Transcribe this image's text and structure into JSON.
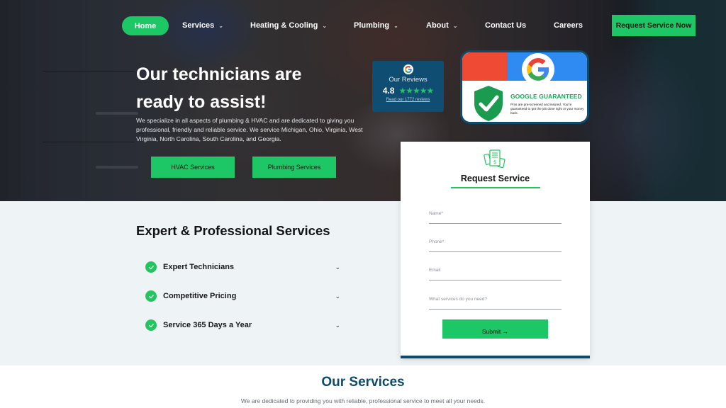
{
  "nav": {
    "items": [
      {
        "label": "Home",
        "dropdown": false,
        "active": true
      },
      {
        "label": "Services",
        "dropdown": true
      },
      {
        "label": "Heating & Cooling",
        "dropdown": true
      },
      {
        "label": "Plumbing",
        "dropdown": true
      },
      {
        "label": "About",
        "dropdown": true
      },
      {
        "label": "Contact Us",
        "dropdown": false
      },
      {
        "label": "Careers",
        "dropdown": false
      }
    ],
    "chevron": "⌄",
    "cta_label": "Request Service Now"
  },
  "hero": {
    "title_line1": "Our technicians are",
    "title_line2": "ready to assist!",
    "description": "We specialize in all aspects of plumbing & HVAC and are dedicated to giving you professional, friendly and reliable service.  We service Michigan, Ohio, Virginia, West Virginia, North Carolina, South Carolina, and Georgia.",
    "buttons": [
      {
        "label": "HVAC Services"
      },
      {
        "label": "Plumbing Services"
      }
    ]
  },
  "reviews_badge": {
    "icon": "google-icon",
    "title": "Our Reviews",
    "rating": "4.8",
    "stars": "★★★★★",
    "star_count": 5,
    "link_text": "Read our 1772 reviews"
  },
  "google_guaranteed": {
    "title": "GOOGLE GUARANTEED",
    "text": "Pros are pre-screened and insured. You're guaranteed to get the job done right or your money back."
  },
  "expert_section": {
    "heading": "Expert & Professional Services",
    "items": [
      {
        "label": "Expert Technicians"
      },
      {
        "label": "Competitive Pricing"
      },
      {
        "label": "Service 365 Days a Year"
      }
    ]
  },
  "request_form": {
    "title": "Request Service",
    "fields": [
      {
        "placeholder": "Name*",
        "value": ""
      },
      {
        "placeholder": "Phone*",
        "value": ""
      },
      {
        "placeholder": "Email",
        "value": ""
      },
      {
        "placeholder": "What services do you need?",
        "value": ""
      }
    ],
    "submit_label": "Submit →"
  },
  "our_services": {
    "title": "Our Services",
    "subtitle": "We are dedicated to providing you with reliable, professional service to meet all your needs."
  },
  "colors": {
    "brand_green": "#1ec765",
    "brand_navy": "#0d4b6d",
    "light_bg": "#eef3f6"
  }
}
